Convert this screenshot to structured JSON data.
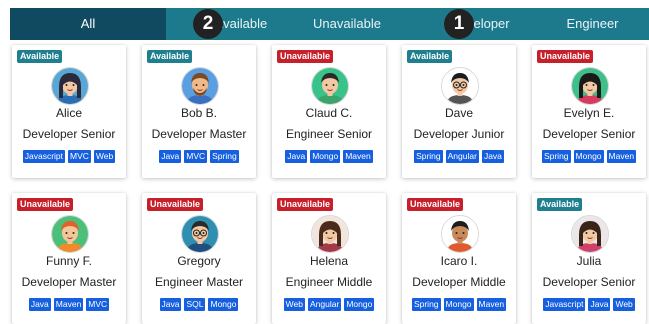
{
  "tabs": [
    {
      "label": "All",
      "active": true
    },
    {
      "label": "Available",
      "active": false
    },
    {
      "label": "Unavailable",
      "active": false
    },
    {
      "label": "Developer",
      "active": false
    },
    {
      "label": "Engineer",
      "active": false
    }
  ],
  "markers": [
    "2",
    "1"
  ],
  "colors": {
    "tabbar": "#1c7a8c",
    "tab_active": "#104a60",
    "available_badge": "#1f7f8e",
    "unavailable_badge": "#c8202a",
    "skill_chip": "#1660e0"
  },
  "people": [
    {
      "name": "Alice",
      "role": "Developer Senior",
      "status": "Available",
      "skills": [
        "Javascript",
        "MVC",
        "Web"
      ],
      "avatar": {
        "skin": "#f1c9a4",
        "hair": "#2a2a3a",
        "shirt": "#2a6fb5",
        "bg": "#5aa7d6"
      }
    },
    {
      "name": "Bob B.",
      "role": "Developer Master",
      "status": "Available",
      "skills": [
        "Java",
        "MVC",
        "Spring"
      ],
      "avatar": {
        "skin": "#f0b987",
        "hair": "#7a4a22",
        "shirt": "#3b6fc0",
        "bg": "#5c9fe0"
      }
    },
    {
      "name": "Claud C.",
      "role": "Engineer Senior",
      "status": "Unavailable",
      "skills": [
        "Java",
        "Mongo",
        "Maven"
      ],
      "avatar": {
        "skin": "#f2c8a2",
        "hair": "#2a2a2a",
        "shirt": "#3aa46a",
        "bg": "#39c28a"
      }
    },
    {
      "name": "Dave",
      "role": "Developer Junior",
      "status": "Available",
      "skills": [
        "Spring",
        "Angular",
        "Java"
      ],
      "avatar": {
        "skin": "#f1c9a4",
        "hair": "#1c1c1c",
        "shirt": "#555555",
        "bg": "#ffffff"
      }
    },
    {
      "name": "Evelyn E.",
      "role": "Developer Senior",
      "status": "Unavailable",
      "skills": [
        "Spring",
        "Mongo",
        "Maven"
      ],
      "avatar": {
        "skin": "#f1c9a4",
        "hair": "#1a1a1a",
        "shirt": "#d83a60",
        "bg": "#3fbf8a"
      }
    },
    {
      "name": "Funny F.",
      "role": "Developer Master",
      "status": "Unavailable",
      "skills": [
        "Java",
        "Maven",
        "MVC"
      ],
      "avatar": {
        "skin": "#f4c79a",
        "hair": "#e2602a",
        "shirt": "#f08a2a",
        "bg": "#4cc07a"
      }
    },
    {
      "name": "Gregory",
      "role": "Engineer Master",
      "status": "Unavailable",
      "skills": [
        "Java",
        "SQL",
        "Mongo"
      ],
      "avatar": {
        "skin": "#f1c9a4",
        "hair": "#2a2a2a",
        "shirt": "#1f4f80",
        "bg": "#2f8fb0"
      }
    },
    {
      "name": "Helena",
      "role": "Engineer Middle",
      "status": "Unavailable",
      "skills": [
        "Web",
        "Angular",
        "Mongo"
      ],
      "avatar": {
        "skin": "#f1c9a4",
        "hair": "#4a2a1a",
        "shirt": "#a23a4a",
        "bg": "#f2e6dc"
      }
    },
    {
      "name": "Icaro I.",
      "role": "Developer Middle",
      "status": "Unavailable",
      "skills": [
        "Spring",
        "Mongo",
        "Maven"
      ],
      "avatar": {
        "skin": "#c98a5a",
        "hair": "#1c1c1c",
        "shirt": "#e05a30",
        "bg": "#ffffff"
      }
    },
    {
      "name": "Julia",
      "role": "Developer Senior",
      "status": "Available",
      "skills": [
        "Javascript",
        "Java",
        "Web"
      ],
      "avatar": {
        "skin": "#f1c9a4",
        "hair": "#3a2418",
        "shirt": "#d0406a",
        "bg": "#eae6ea"
      }
    }
  ]
}
